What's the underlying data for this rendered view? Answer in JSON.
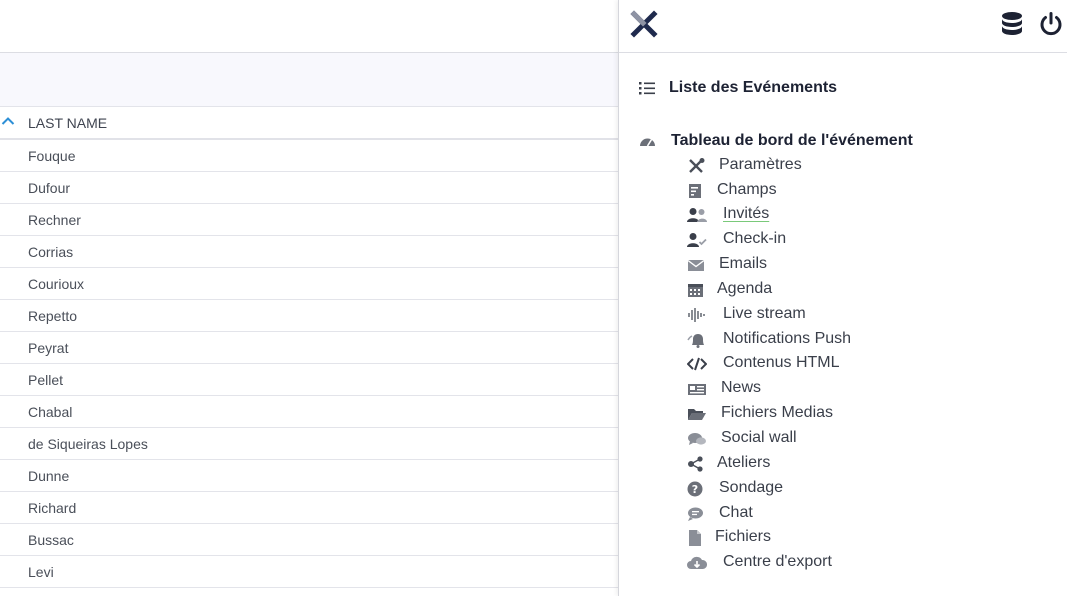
{
  "table": {
    "column_header": "LAST NAME",
    "rows": [
      "Fouque",
      "Dufour",
      "Rechner",
      "Corrias",
      "Courioux",
      "Repetto",
      "Peyrat",
      "Pellet",
      "Chabal",
      "de Siqueiras Lopes",
      "Dunne",
      "Richard",
      "Bussac",
      "Levi"
    ]
  },
  "sidebar": {
    "event_list_label": "Liste des Evénements",
    "dashboard_label": "Tableau de bord de l'événement",
    "items": [
      {
        "label": "Paramètres",
        "icon": "tools-icon"
      },
      {
        "label": "Champs",
        "icon": "form-icon"
      },
      {
        "label": "Invités",
        "icon": "users-icon"
      },
      {
        "label": "Check-in",
        "icon": "user-check-icon"
      },
      {
        "label": "Emails",
        "icon": "envelope-icon"
      },
      {
        "label": "Agenda",
        "icon": "calendar-icon"
      },
      {
        "label": "Live stream",
        "icon": "waveform-icon"
      },
      {
        "label": "Notifications Push",
        "icon": "bell-icon"
      },
      {
        "label": "Contenus HTML",
        "icon": "code-icon"
      },
      {
        "label": "News",
        "icon": "newspaper-icon"
      },
      {
        "label": "Fichiers Medias",
        "icon": "folder-open-icon"
      },
      {
        "label": "Social wall",
        "icon": "comments-icon"
      },
      {
        "label": "Ateliers",
        "icon": "share-nodes-icon"
      },
      {
        "label": "Sondage",
        "icon": "question-circle-icon"
      },
      {
        "label": "Chat",
        "icon": "chat-bubble-icon"
      },
      {
        "label": "Fichiers",
        "icon": "file-icon"
      },
      {
        "label": "Centre d'export",
        "icon": "cloud-download-icon"
      }
    ]
  },
  "colors": {
    "accent_blue": "#2d8fd6",
    "navy": "#1d2233",
    "icon_gray": "#6b6f78"
  }
}
